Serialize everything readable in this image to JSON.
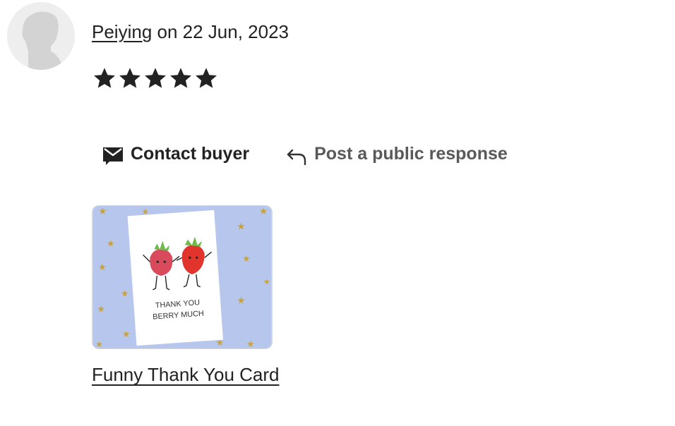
{
  "review": {
    "reviewer_name": "Peiying",
    "date_text": " on 22 Jun, 2023",
    "rating": 5,
    "max_rating": 5,
    "star_color": "#222222"
  },
  "actions": {
    "contact_label": "Contact buyer",
    "contact_icon": "envelope-icon",
    "public_label": "Post a public response",
    "public_icon": "reply-arrow-icon"
  },
  "product": {
    "title": "Funny Thank You Card",
    "image_text_line1": "THANK YOU",
    "image_text_line2": "BERRY MUCH",
    "image_background": "#b7c6ec"
  }
}
